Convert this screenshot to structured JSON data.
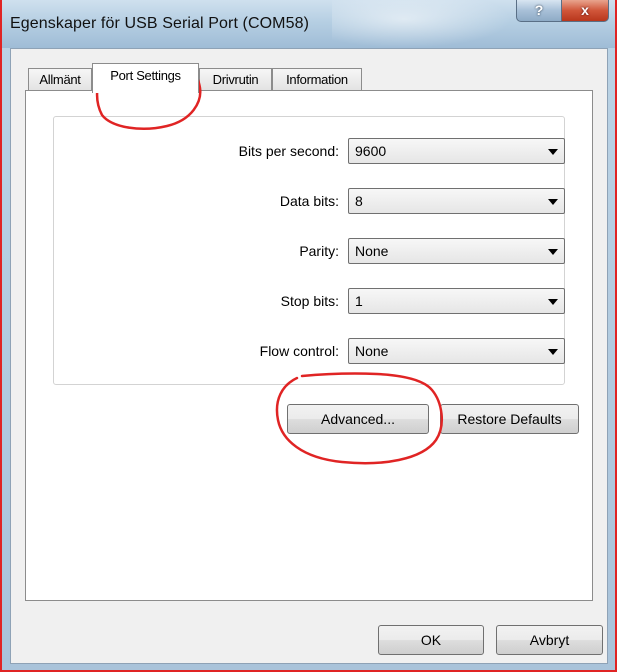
{
  "window": {
    "title": "Egenskaper för USB Serial Port (COM58)",
    "help_label": "?",
    "close_label": "x"
  },
  "tabs": [
    {
      "label": "Allmänt"
    },
    {
      "label": "Port Settings"
    },
    {
      "label": "Drivrutin"
    },
    {
      "label": "Information"
    }
  ],
  "fields": [
    {
      "label": "Bits per second:",
      "value": "9600"
    },
    {
      "label": "Data bits:",
      "value": "8"
    },
    {
      "label": "Parity:",
      "value": "None"
    },
    {
      "label": "Stop bits:",
      "value": "1"
    },
    {
      "label": "Flow control:",
      "value": "None"
    }
  ],
  "buttons": {
    "advanced": "Advanced...",
    "restore_defaults": "Restore Defaults",
    "ok": "OK",
    "cancel": "Avbryt"
  },
  "colors": {
    "annotation": "#e02424",
    "window_border": "#e02424"
  }
}
